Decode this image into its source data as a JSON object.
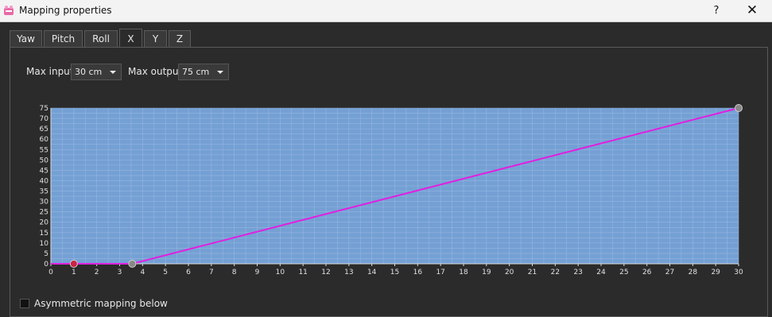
{
  "window": {
    "title": "Mapping properties",
    "help": "?",
    "close": "✕"
  },
  "tabs": [
    {
      "label": "Yaw"
    },
    {
      "label": "Pitch"
    },
    {
      "label": "Roll"
    },
    {
      "label": "X",
      "active": true
    },
    {
      "label": "Y"
    },
    {
      "label": "Z"
    }
  ],
  "controls": {
    "max_input_label": "Max input",
    "max_input_value": "30 cm",
    "max_output_label": "Max output",
    "max_output_value": "75 cm"
  },
  "chart_data": {
    "type": "line",
    "xlim": [
      0,
      30
    ],
    "ylim": [
      0,
      75
    ],
    "x_ticks": [
      "0",
      "1",
      "2",
      "3",
      "4",
      "5",
      "6",
      "7",
      "8",
      "9",
      "10",
      "11",
      "12",
      "13",
      "14",
      "15",
      "16",
      "17",
      "18",
      "19",
      "20",
      "21",
      "22",
      "23",
      "24",
      "25",
      "26",
      "27",
      "28",
      "29",
      "30"
    ],
    "y_ticks": [
      "0",
      "5",
      "10",
      "15",
      "20",
      "25",
      "30",
      "35",
      "40",
      "45",
      "50",
      "55",
      "60",
      "65",
      "70",
      "75"
    ],
    "series": [
      {
        "x": [
          0,
          1,
          3.55,
          30
        ],
        "y": [
          0,
          0,
          0,
          75
        ]
      }
    ],
    "control_points": [
      {
        "x": 1,
        "y": 0,
        "state": "selected"
      },
      {
        "x": 3.55,
        "y": 0,
        "state": "normal"
      },
      {
        "x": 30,
        "y": 75,
        "state": "normal"
      }
    ],
    "grid": true,
    "colors": {
      "plot_bg": "#74a0d4",
      "line": "#e020e0",
      "grid": "#9dbbe3",
      "point": "#888888",
      "point_selected": "#cc2244"
    }
  },
  "asymmetric": {
    "label": "Asymmetric mapping below",
    "checked": false
  }
}
